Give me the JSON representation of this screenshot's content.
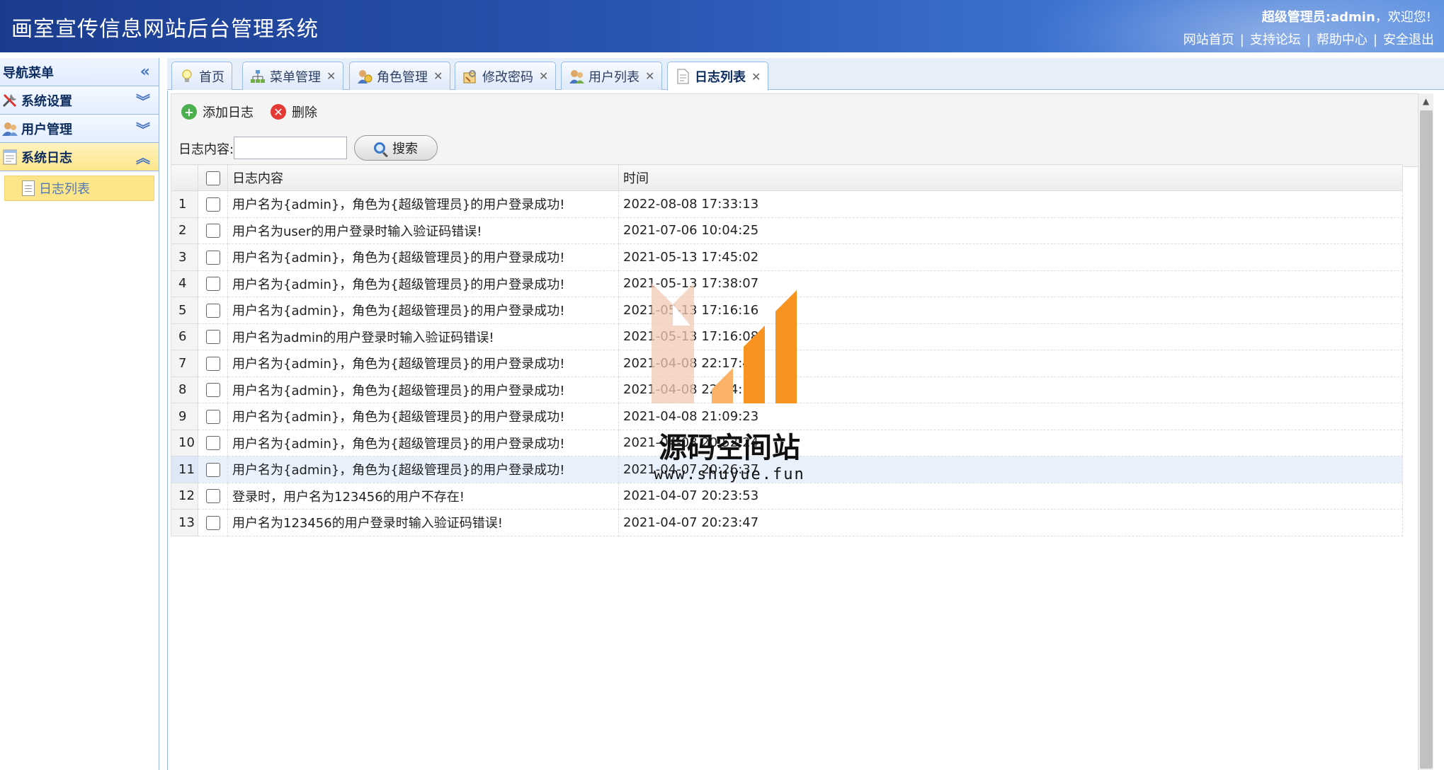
{
  "header": {
    "title": "画室宣传信息网站后台管理系统",
    "welcome_role": "超级管理员:admin",
    "welcome_suffix": "，欢迎您!",
    "links": [
      "网站首页",
      "支持论坛",
      "帮助中心",
      "安全退出"
    ]
  },
  "sidebar": {
    "title": "导航菜单",
    "groups": [
      {
        "label": "系统设置",
        "icon": "tools-icon"
      },
      {
        "label": "用户管理",
        "icon": "users-icon"
      },
      {
        "label": "系统日志",
        "icon": "log-icon"
      }
    ],
    "sub_item": "日志列表"
  },
  "tabs": [
    {
      "label": "首页",
      "icon": "lightbulb-icon",
      "closable": false
    },
    {
      "label": "菜单管理",
      "icon": "tree-icon",
      "closable": true
    },
    {
      "label": "角色管理",
      "icon": "role-icon",
      "closable": true
    },
    {
      "label": "修改密码",
      "icon": "key-icon",
      "closable": true
    },
    {
      "label": "用户列表",
      "icon": "user-list-icon",
      "closable": true
    },
    {
      "label": "日志列表",
      "icon": "document-icon",
      "closable": true,
      "active": true
    }
  ],
  "toolbar": {
    "add_label": "添加日志",
    "delete_label": "删除",
    "search_label": "日志内容:",
    "search_value": "",
    "search_button": "搜索"
  },
  "grid": {
    "columns": [
      "日志内容",
      "时间"
    ],
    "rows": [
      {
        "n": "1",
        "content": "用户名为{admin}，角色为{超级管理员}的用户登录成功!",
        "time": "2022-08-08 17:33:13"
      },
      {
        "n": "2",
        "content": "用户名为user的用户登录时输入验证码错误!",
        "time": "2021-07-06 10:04:25"
      },
      {
        "n": "3",
        "content": "用户名为{admin}，角色为{超级管理员}的用户登录成功!",
        "time": "2021-05-13 17:45:02"
      },
      {
        "n": "4",
        "content": "用户名为{admin}，角色为{超级管理员}的用户登录成功!",
        "time": "2021-05-13 17:38:07"
      },
      {
        "n": "5",
        "content": "用户名为{admin}，角色为{超级管理员}的用户登录成功!",
        "time": "2021-05-13 17:16:16"
      },
      {
        "n": "6",
        "content": "用户名为admin的用户登录时输入验证码错误!",
        "time": "2021-05-13 17:16:08"
      },
      {
        "n": "7",
        "content": "用户名为{admin}，角色为{超级管理员}的用户登录成功!",
        "time": "2021-04-08 22:17:46"
      },
      {
        "n": "8",
        "content": "用户名为{admin}，角色为{超级管理员}的用户登录成功!",
        "time": "2021-04-08 22:04:14"
      },
      {
        "n": "9",
        "content": "用户名为{admin}，角色为{超级管理员}的用户登录成功!",
        "time": "2021-04-08 21:09:23"
      },
      {
        "n": "10",
        "content": "用户名为{admin}，角色为{超级管理员}的用户登录成功!",
        "time": "2021-04-08 20:52:24"
      },
      {
        "n": "11",
        "content": "用户名为{admin}，角色为{超级管理员}的用户登录成功!",
        "time": "2021-04-07 20:26:37"
      },
      {
        "n": "12",
        "content": "登录时，用户名为123456的用户不存在!",
        "time": "2021-04-07 20:23:53"
      },
      {
        "n": "13",
        "content": "用户名为123456的用户登录时输入验证码错误!",
        "time": "2021-04-07 20:23:47"
      }
    ],
    "highlight_row": 11
  },
  "watermark": {
    "title": "源码空间站",
    "url": "www.shuyue.fun"
  },
  "colors": {
    "header": "#2a55b3",
    "border": "#99bbe8",
    "active_nav": "#fde68a",
    "add": "#4caf50",
    "delete": "#e53935",
    "logo_orange": "#f7931e"
  }
}
